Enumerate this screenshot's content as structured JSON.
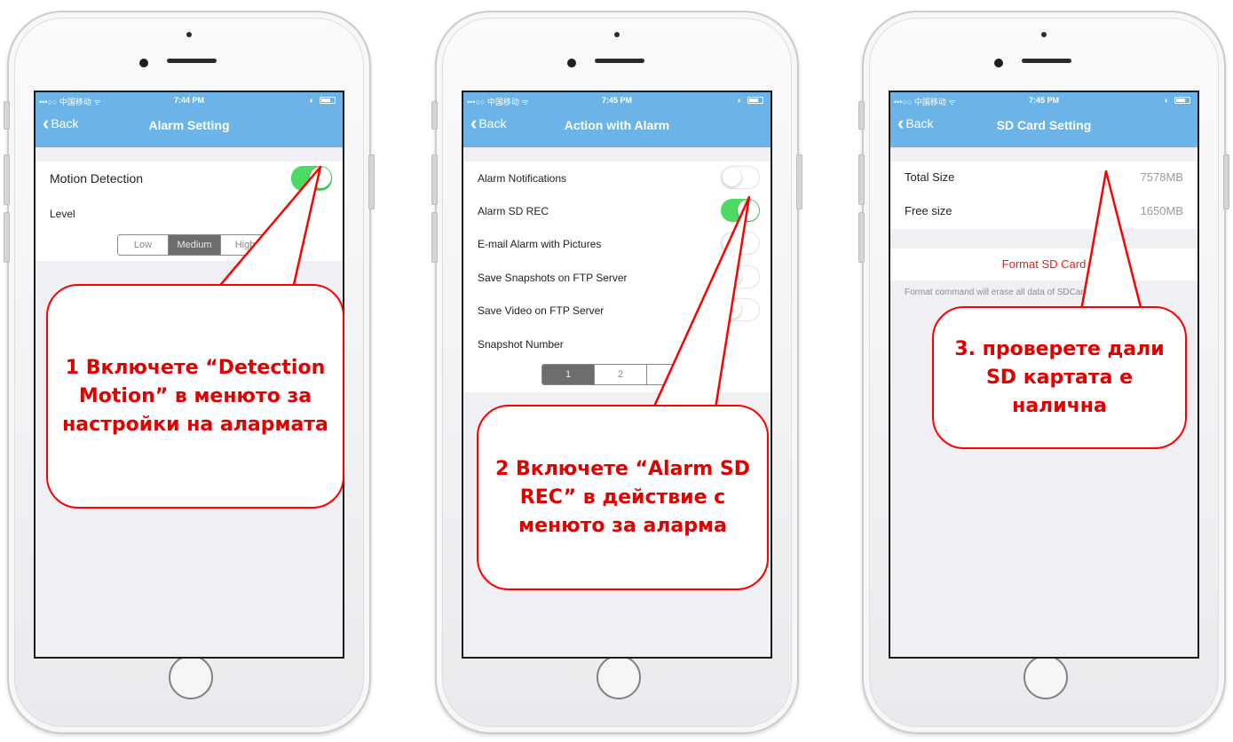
{
  "phones": [
    {
      "status": {
        "carrier": "•••○○ 中国移动 ᯤ",
        "time": "7:44 PM"
      },
      "nav": {
        "back": "Back",
        "title": "Alarm Setting"
      },
      "motion_label": "Motion Detection",
      "level_label": "Level",
      "level_options": [
        "Low",
        "Medium",
        "High"
      ],
      "level_selected": "Medium",
      "motion_enabled": true,
      "callout": "1 Включете “Detection Motion” в менюто за настройки на алармата"
    },
    {
      "status": {
        "carrier": "•••○○ 中国移动 ᯤ",
        "time": "7:45 PM"
      },
      "nav": {
        "back": "Back",
        "title": "Action with Alarm"
      },
      "options": [
        {
          "label": "Alarm Notifications",
          "on": false
        },
        {
          "label": "Alarm SD REC",
          "on": true
        },
        {
          "label": "E-mail Alarm with Pictures",
          "on": false
        },
        {
          "label": "Save Snapshots on FTP Server",
          "on": false
        },
        {
          "label": "Save Video on FTP Server",
          "on": false
        }
      ],
      "snapshot_label": "Snapshot Number",
      "snapshot_options": [
        "1",
        "2",
        "3"
      ],
      "snapshot_selected": "1",
      "callout": "2 Включете “Alarm SD REC” в действие с менюто за аларма"
    },
    {
      "status": {
        "carrier": "•••○○ 中国移动 ᯤ",
        "time": "7:45 PM"
      },
      "nav": {
        "back": "Back",
        "title": "SD Card Setting"
      },
      "total_label": "Total Size",
      "total_value": "7578MB",
      "free_label": "Free size",
      "free_value": "1650MB",
      "format_button": "Format SD Card",
      "format_note": "Format command will erase all data of SDCard",
      "callout": "3. проверете дали SD картата е налична"
    }
  ],
  "colors": {
    "nav": "#6cb4e8",
    "switch_on": "#4cd964",
    "callout": "#ff0000",
    "format": "#e02020"
  },
  "icons": {
    "back": "chevron-left-icon",
    "battery": "battery-icon",
    "wifi": "wifi-icon"
  }
}
